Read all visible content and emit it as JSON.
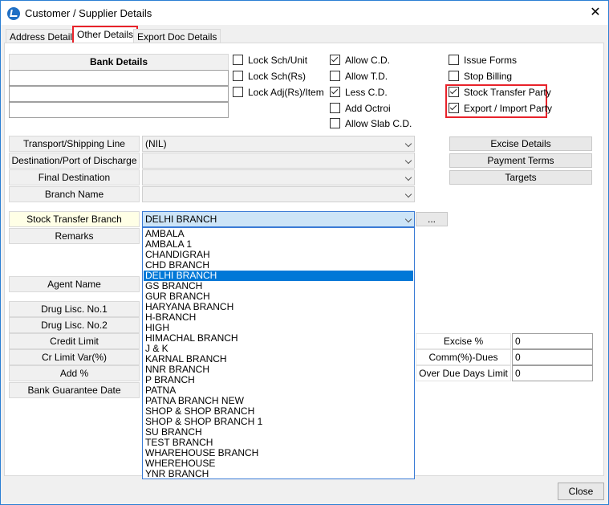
{
  "window": {
    "title": "Customer / Supplier Details",
    "close_glyph": "✕"
  },
  "tabs": [
    "Address Details",
    "Other Details",
    "Export Doc Details"
  ],
  "bank": {
    "header": "Bank Details"
  },
  "checks": {
    "col1": [
      {
        "label": "Lock Sch/Unit",
        "checked": false
      },
      {
        "label": "Lock Sch(Rs)",
        "checked": false
      },
      {
        "label": "Lock Adj(Rs)/Item",
        "checked": false
      }
    ],
    "col2": [
      {
        "label": "Allow C.D.",
        "checked": true
      },
      {
        "label": "Allow T.D.",
        "checked": false
      },
      {
        "label": "Less C.D.",
        "checked": true
      },
      {
        "label": "Add Octroi",
        "checked": false
      },
      {
        "label": "Allow Slab C.D.",
        "checked": false
      }
    ],
    "col3": [
      {
        "label": "Issue Forms",
        "checked": false
      },
      {
        "label": "Stop Billing",
        "checked": false
      },
      {
        "label": "Stock Transfer Party",
        "checked": true
      },
      {
        "label": "Export / Import Party",
        "checked": true
      }
    ]
  },
  "fields": {
    "transport": {
      "label": "Transport/Shipping Line",
      "value": "(NIL)"
    },
    "destination": {
      "label": "Destination/Port of Discharge",
      "value": ""
    },
    "final_destination": {
      "label": "Final Destination",
      "value": ""
    },
    "branch_name": {
      "label": "Branch Name",
      "value": ""
    },
    "stock_transfer_branch": {
      "label": "Stock Transfer Branch",
      "value": "DELHI BRANCH",
      "ellipsis": "..."
    },
    "remarks": {
      "label": "Remarks"
    },
    "agent_name": {
      "label": "Agent Name"
    },
    "drug1": {
      "label": "Drug Lisc. No.1"
    },
    "drug2": {
      "label": "Drug Lisc. No.2"
    },
    "credit_limit": {
      "label": "Credit Limit"
    },
    "cr_limit_var": {
      "label": "Cr Limit Var(%)"
    },
    "add_pct": {
      "label": "Add %"
    },
    "bank_guarantee": {
      "label": "Bank Guarantee Date"
    }
  },
  "side_buttons": [
    "Excise Details",
    "Payment Terms",
    "Targets"
  ],
  "right_fields": [
    {
      "label": "Excise %",
      "value": "0"
    },
    {
      "label": "Comm(%)-Dues",
      "value": "0"
    },
    {
      "label": "Over Due Days Limit",
      "value": "0"
    }
  ],
  "dropdown": {
    "selected": "DELHI BRANCH",
    "options": [
      "AMBALA",
      "AMBALA 1",
      "CHANDIGRAH",
      "CHD BRANCH",
      "DELHI BRANCH",
      "GS BRANCH",
      "GUR BRANCH",
      "HARYANA BRANCH",
      "H-BRANCH",
      "HIGH",
      "HIMACHAL BRANCH",
      "J & K",
      "KARNAL BRANCH",
      "NNR BRANCH",
      "P BRANCH",
      "PATNA",
      "PATNA BRANCH NEW",
      "SHOP & SHOP BRANCH",
      "SHOP & SHOP BRANCH 1",
      "SU BRANCH",
      "TEST BRANCH",
      "WHAREHOUSE BRANCH",
      "WHEREHOUSE",
      "YNR BRANCH"
    ]
  },
  "footer": {
    "close_label": "Close"
  }
}
